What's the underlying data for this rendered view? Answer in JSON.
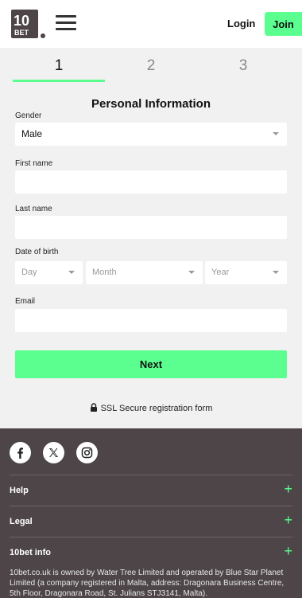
{
  "brand": {
    "logo_text_top": "10",
    "logo_text_bottom": "BET"
  },
  "header": {
    "login_label": "Login",
    "join_label": "Join"
  },
  "steps": [
    {
      "label": "1"
    },
    {
      "label": "2"
    },
    {
      "label": "3"
    }
  ],
  "active_step": 1,
  "form": {
    "title": "Personal Information",
    "gender": {
      "label": "Gender",
      "value": "Male"
    },
    "first_name": {
      "label": "First name",
      "value": ""
    },
    "last_name": {
      "label": "Last name",
      "value": ""
    },
    "dob": {
      "label": "Date of birth",
      "day": "Day",
      "month": "Month",
      "year": "Year"
    },
    "email": {
      "label": "Email",
      "value": ""
    },
    "next_label": "Next",
    "ssl_text": "SSL Secure registration form"
  },
  "footer": {
    "social": [
      {
        "icon": "facebook-icon"
      },
      {
        "icon": "x-icon"
      },
      {
        "icon": "instagram-icon"
      }
    ],
    "sections": [
      {
        "label": "Help"
      },
      {
        "label": "Legal"
      },
      {
        "label": "10bet info"
      }
    ],
    "legal_text": "10bet.co.uk is owned by Water Tree Limited and operated by Blue Star Planet Limited (a company registered in Malta, address: Dragonara Business Centre, 5th Floor, Dragonara Road, St. Julians STJ3141, Malta)."
  },
  "colors": {
    "accent": "#5bff8f",
    "footer_bg": "#4d4548",
    "form_bg": "#f1f1f1"
  }
}
